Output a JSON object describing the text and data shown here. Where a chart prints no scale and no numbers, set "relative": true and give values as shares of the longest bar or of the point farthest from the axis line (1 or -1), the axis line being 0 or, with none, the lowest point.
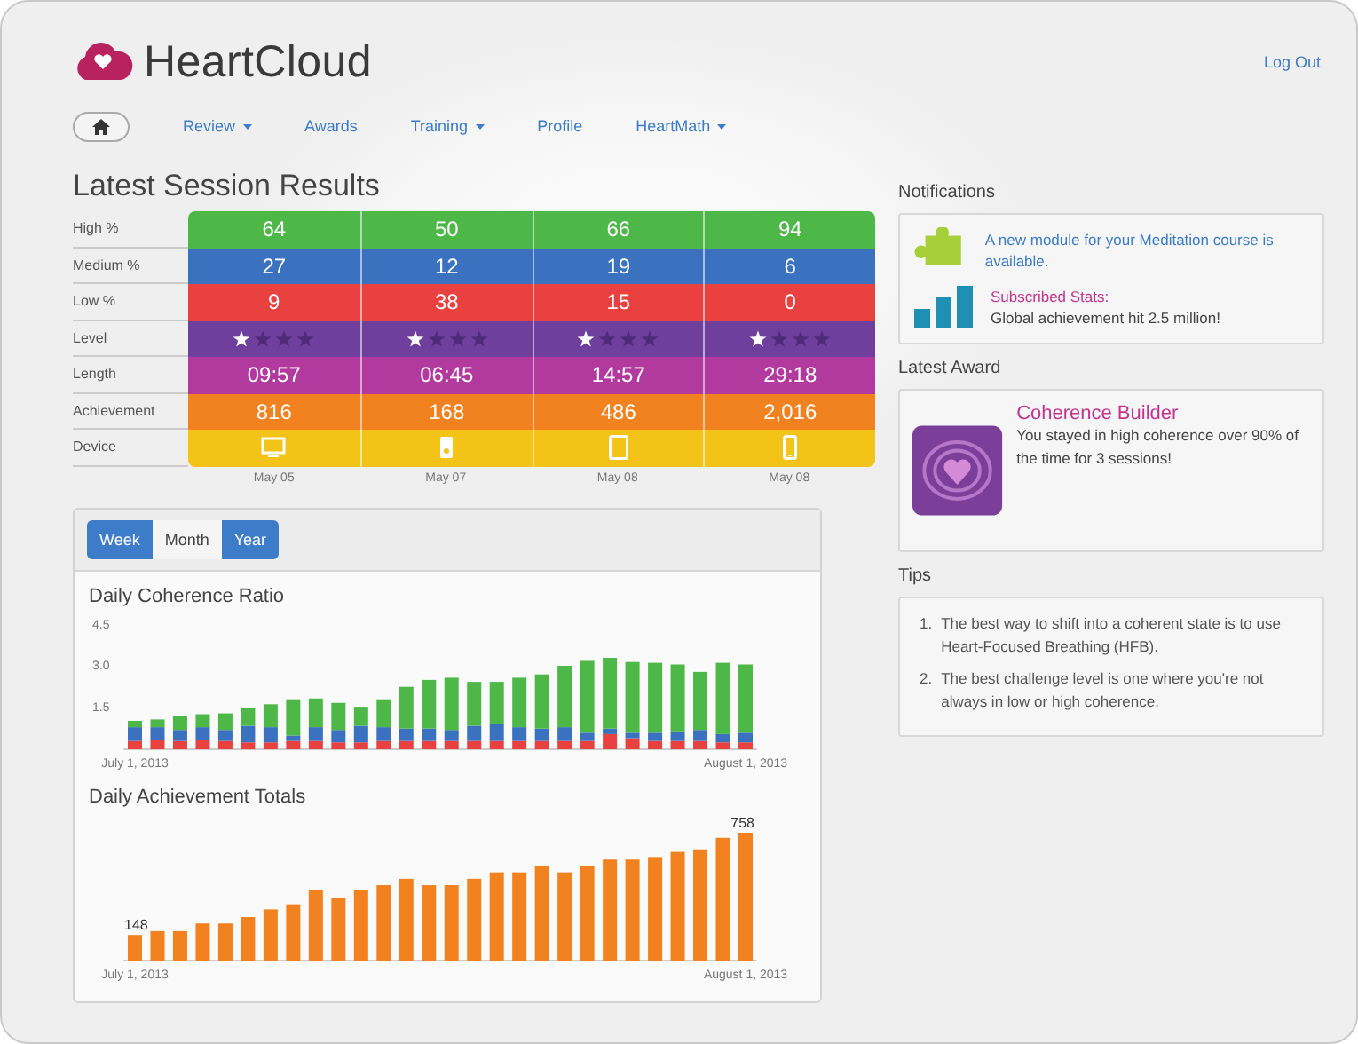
{
  "header": {
    "brand": "HeartCloud",
    "logout": "Log Out"
  },
  "nav": [
    {
      "kind": "home"
    },
    {
      "kind": "link",
      "label": "Review",
      "dropdown": true
    },
    {
      "kind": "link",
      "label": "Awards",
      "dropdown": false
    },
    {
      "kind": "link",
      "label": "Training",
      "dropdown": true
    },
    {
      "kind": "link",
      "label": "Profile",
      "dropdown": false
    },
    {
      "kind": "link",
      "label": "HeartMath",
      "dropdown": true
    }
  ],
  "session": {
    "title": "Latest Session Results",
    "rows": [
      {
        "label": "High %",
        "kind": "text",
        "color": "#4db848",
        "cells": [
          {
            "text": "64"
          },
          {
            "text": "50"
          },
          {
            "text": "66"
          },
          {
            "text": "94"
          }
        ]
      },
      {
        "label": "Medium %",
        "kind": "text",
        "color": "#3a72c0",
        "cells": [
          {
            "text": "27"
          },
          {
            "text": "12"
          },
          {
            "text": "19"
          },
          {
            "text": "6"
          }
        ]
      },
      {
        "label": "Low %",
        "kind": "text",
        "color": "#e8413f",
        "cells": [
          {
            "text": "9"
          },
          {
            "text": "38"
          },
          {
            "text": "15"
          },
          {
            "text": "0"
          }
        ]
      },
      {
        "label": "Level",
        "kind": "stars",
        "color": "#6e3f9c",
        "cells": [
          {
            "stars": 1
          },
          {
            "stars": 1
          },
          {
            "stars": 1
          },
          {
            "stars": 1
          }
        ]
      },
      {
        "label": "Length",
        "kind": "text",
        "color": "#b23a9e",
        "cells": [
          {
            "text": "09:57"
          },
          {
            "text": "06:45"
          },
          {
            "text": "14:57"
          },
          {
            "text": "29:18"
          }
        ]
      },
      {
        "label": "Achievement",
        "kind": "text",
        "color": "#f2821f",
        "cells": [
          {
            "text": "816"
          },
          {
            "text": "168"
          },
          {
            "text": "486"
          },
          {
            "text": "2,016"
          }
        ]
      },
      {
        "label": "Device",
        "kind": "device",
        "color": "#f3c417",
        "cells": [
          {
            "kind": "monitor"
          },
          {
            "kind": "ipod"
          },
          {
            "kind": "tablet"
          },
          {
            "kind": "phone"
          }
        ]
      }
    ],
    "dates": [
      "May 05",
      "May 07",
      "May 08",
      "May 08"
    ]
  },
  "chart_panel": {
    "tabs": [
      {
        "label": "Week",
        "selected": false
      },
      {
        "label": "Month",
        "selected": true
      },
      {
        "label": "Year",
        "selected": false
      }
    ],
    "coherence": {
      "chart_data": {
        "type": "bar",
        "title": "Daily Coherence Ratio",
        "stacked": true,
        "categories": [
          "July 1, 2013",
          null,
          null,
          null,
          null,
          null,
          null,
          null,
          null,
          null,
          null,
          null,
          null,
          null,
          null,
          null,
          null,
          null,
          null,
          null,
          null,
          null,
          null,
          null,
          null,
          null,
          null,
          "August 1, 2013"
        ],
        "ylim": [
          0,
          4.5
        ],
        "yticks": [
          {
            "value": 1.5,
            "label": "1.5"
          },
          {
            "value": 3.0,
            "label": "3.0"
          },
          {
            "value": 4.5,
            "label": "4.5"
          }
        ],
        "series": [
          {
            "color": "#e8413f",
            "values": [
              0.3,
              0.35,
              0.3,
              0.35,
              0.3,
              0.25,
              0.25,
              0.3,
              0.3,
              0.25,
              0.25,
              0.3,
              0.3,
              0.3,
              0.3,
              0.3,
              0.3,
              0.3,
              0.3,
              0.3,
              0.3,
              0.55,
              0.4,
              0.3,
              0.3,
              0.3,
              0.25,
              0.25
            ]
          },
          {
            "color": "#3a72c0",
            "values": [
              0.5,
              0.45,
              0.4,
              0.45,
              0.4,
              0.6,
              0.55,
              0.2,
              0.5,
              0.45,
              0.6,
              0.5,
              0.45,
              0.45,
              0.4,
              0.55,
              0.6,
              0.5,
              0.45,
              0.5,
              0.3,
              0.2,
              0.2,
              0.3,
              0.35,
              0.4,
              0.3,
              0.35
            ]
          },
          {
            "color": "#4db848",
            "values": [
              0.23,
              0.28,
              0.49,
              0.47,
              0.6,
              0.65,
              0.83,
              1.31,
              1.04,
              0.98,
              0.69,
              1.01,
              1.51,
              1.76,
              1.89,
              1.59,
              1.54,
              1.79,
              1.96,
              2.22,
              2.6,
              2.56,
              2.56,
              2.53,
              2.42,
              2.1,
              2.58,
              2.47
            ]
          }
        ]
      }
    },
    "achievement": {
      "chart_data": {
        "type": "bar",
        "title": "Daily Achievement Totals",
        "relative": true,
        "categories": [
          "July 1, 2013",
          null,
          null,
          null,
          null,
          null,
          null,
          null,
          null,
          null,
          null,
          null,
          null,
          null,
          null,
          null,
          null,
          null,
          null,
          null,
          null,
          null,
          null,
          null,
          null,
          null,
          null,
          "August 1, 2013"
        ],
        "series": [
          {
            "color": "#f2821f",
            "values": [
              0.2,
              0.23,
              0.23,
              0.29,
              0.29,
              0.34,
              0.4,
              0.44,
              0.55,
              0.49,
              0.55,
              0.59,
              0.64,
              0.59,
              0.59,
              0.64,
              0.69,
              0.69,
              0.74,
              0.69,
              0.74,
              0.79,
              0.79,
              0.81,
              0.85,
              0.87,
              0.96,
              1.0
            ]
          }
        ],
        "value_labels": [
          "148",
          null,
          null,
          null,
          null,
          null,
          null,
          null,
          null,
          null,
          null,
          null,
          null,
          null,
          null,
          null,
          null,
          null,
          null,
          null,
          null,
          null,
          null,
          null,
          null,
          null,
          null,
          "758"
        ]
      }
    }
  },
  "notifications": {
    "title": "Notifications",
    "items": [
      {
        "kind": "puzzle",
        "link": "A new module for your Meditation course is available."
      },
      {
        "kind": "stats",
        "title": "Subscribed Stats:",
        "text": "Global achievement hit 2.5 million!"
      }
    ]
  },
  "award": {
    "heading": "Latest Award",
    "title": "Coherence Builder",
    "text": "You stayed in high coherence over 90% of the time for 3 sessions!"
  },
  "tips": {
    "title": "Tips",
    "items": [
      {
        "number": "1.",
        "text": "The best way to shift into a coherent state is to use Heart-Focused Breathing (HFB)."
      },
      {
        "number": "2.",
        "text": "The best challenge level is one where you're not always in low or high coherence."
      }
    ]
  }
}
